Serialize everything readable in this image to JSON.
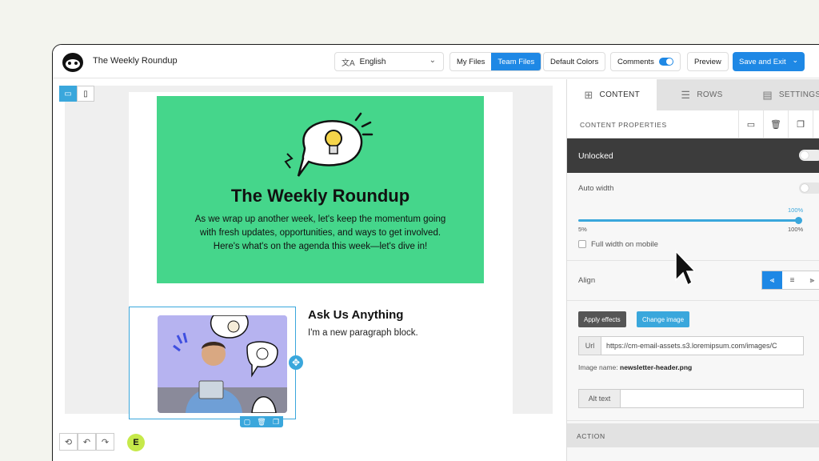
{
  "app": {
    "title": "The Weekly Roundup"
  },
  "topbar": {
    "language": "English",
    "my_files": "My Files",
    "team_files": "Team Files",
    "default_colors": "Default Colors",
    "comments": "Comments",
    "preview": "Preview",
    "save_exit": "Save and Exit"
  },
  "email": {
    "hero_title": "The Weekly Roundup",
    "hero_body": "As we wrap up another week, let's keep the momentum going with fresh updates, opportunities, and ways to get involved. Here's what's on the agenda this week—let's dive in!",
    "ask_title": "Ask Us Anything",
    "ask_body": "I'm a new paragraph block."
  },
  "canvas": {
    "editor_badge": "E"
  },
  "panel": {
    "tabs": [
      {
        "label": "CONTENT",
        "icon": "grid-icon"
      },
      {
        "label": "ROWS",
        "icon": "rows-icon"
      },
      {
        "label": "SETTINGS",
        "icon": "settings-icon"
      }
    ],
    "content_properties": "CONTENT PROPERTIES",
    "unlocked": "Unlocked",
    "auto_width": "Auto width",
    "slider_value_label": "100%",
    "slider_value": 100,
    "slider_min": "5%",
    "slider_max": "100%",
    "full_width_mobile": "Full width on mobile",
    "align": "Align",
    "apply_effects": "Apply effects",
    "change_image": "Change image",
    "url_label": "Url",
    "url_value": "https://cm-email-assets.s3.loremipsum.com/images/C",
    "image_name_label": "Image name:",
    "image_name": "newsletter-header.png",
    "alt_label": "Alt text",
    "alt_value": "",
    "action": "ACTION"
  },
  "colors": {
    "accent": "#1e88e5",
    "hero_green": "#45d68b",
    "selection": "#3aa7dc"
  }
}
